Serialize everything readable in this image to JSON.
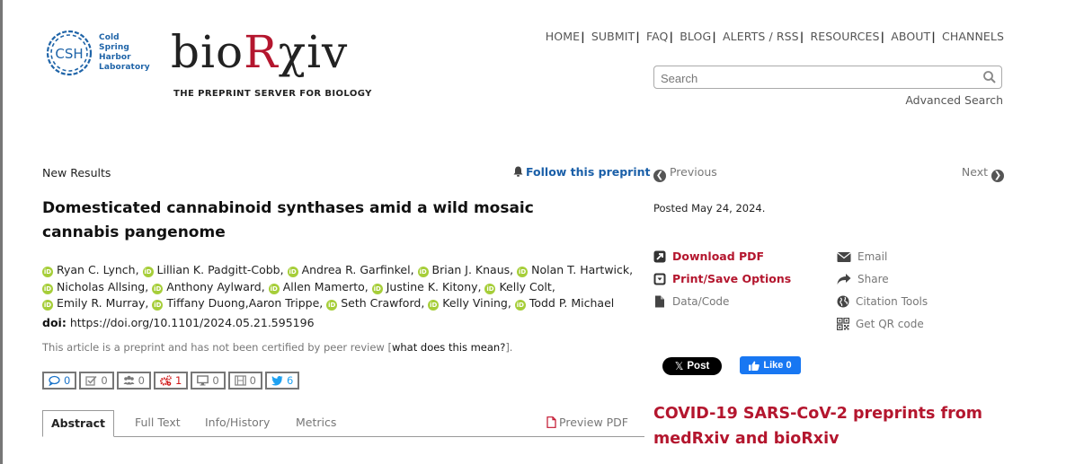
{
  "header": {
    "csh_logo_lines": [
      "Cold",
      "Spring",
      "Harbor",
      "Laboratory"
    ],
    "csh_monogram": "CSH",
    "logo": {
      "part1": "bio",
      "part2": "R",
      "part3": "χiv"
    },
    "tagline": "THE PREPRINT SERVER FOR BIOLOGY",
    "nav": [
      "HOME",
      "SUBMIT",
      "FAQ",
      "BLOG",
      "ALERTS / RSS",
      "RESOURCES",
      "ABOUT",
      "CHANNELS"
    ],
    "search": {
      "placeholder": "Search",
      "value": ""
    },
    "advanced_search": "Advanced Search"
  },
  "article": {
    "section": "New Results",
    "follow": "Follow this preprint",
    "title": "Domesticated cannabinoid synthases amid a wild mosaic cannabis pangenome",
    "authors": [
      {
        "name": "Ryan C. Lynch",
        "orcid": true
      },
      {
        "name": "Lillian K. Padgitt-Cobb",
        "orcid": true
      },
      {
        "name": "Andrea R. Garfinkel",
        "orcid": true
      },
      {
        "name": "Brian J. Knaus",
        "orcid": true
      },
      {
        "name": "Nolan T. Hartwick",
        "orcid": true
      },
      {
        "name": "Nicholas Allsing",
        "orcid": true
      },
      {
        "name": "Anthony Aylward",
        "orcid": true
      },
      {
        "name": "Allen Mamerto",
        "orcid": true
      },
      {
        "name": "Justine K. Kitony",
        "orcid": true
      },
      {
        "name": "Kelly Colt",
        "orcid": true
      },
      {
        "name": "Emily R. Murray",
        "orcid": true
      },
      {
        "name": "Tiffany Duong",
        "orcid": true
      },
      {
        "name": "Aaron Trippe",
        "orcid": false
      },
      {
        "name": "Seth Crawford",
        "orcid": true
      },
      {
        "name": "Kelly Vining",
        "orcid": true
      },
      {
        "name": "Todd P. Michael",
        "orcid": true
      }
    ],
    "doi_label": "doi:",
    "doi": "https://doi.org/10.1101/2024.05.21.595196",
    "disclaimer": "This article is a preprint and has not been certified by peer review [",
    "disclaimer_link": "what does this mean?",
    "disclaimer_end": "].",
    "metrics": [
      {
        "icon": "comment-icon",
        "value": "0",
        "color": "#1a73c9"
      },
      {
        "icon": "checkbox-icon",
        "value": "0",
        "color": "#777777"
      },
      {
        "icon": "users-icon",
        "value": "0",
        "color": "#777777"
      },
      {
        "icon": "gears-icon",
        "value": "1",
        "color": "#d01818"
      },
      {
        "icon": "monitor-icon",
        "value": "0",
        "color": "#777777"
      },
      {
        "icon": "film-icon",
        "value": "0",
        "color": "#777777"
      },
      {
        "icon": "twitter-icon",
        "value": "6",
        "color": "#1da1f2"
      }
    ],
    "tabs": [
      {
        "label": "Abstract",
        "active": true
      },
      {
        "label": "Full Text",
        "active": false
      },
      {
        "label": "Info/History",
        "active": false
      },
      {
        "label": "Metrics",
        "active": false
      }
    ],
    "preview_pdf": "Preview PDF"
  },
  "sidebar": {
    "previous": "Previous",
    "next": "Next",
    "posted": "Posted May 24, 2024.",
    "actions_left": [
      {
        "label": "Download PDF",
        "icon": "external-link-icon",
        "style": "red"
      },
      {
        "label": "Print/Save Options",
        "icon": "dropdown-box-icon",
        "style": "red"
      },
      {
        "label": "Data/Code",
        "icon": "file-icon",
        "style": "gray"
      }
    ],
    "actions_right": [
      {
        "label": "Email",
        "icon": "envelope-icon"
      },
      {
        "label": "Share",
        "icon": "share-icon"
      },
      {
        "label": "Citation Tools",
        "icon": "globe-icon"
      },
      {
        "label": "Get QR code",
        "icon": "qr-code-icon"
      }
    ],
    "x_post": "Post",
    "fb_like": "Like 0",
    "covid_heading": "COVID-19 SARS-CoV-2 preprints from medRxiv and bioRxiv"
  },
  "colors": {
    "brand_red": "#b4162e",
    "link_blue": "#1a5fa8",
    "orcid_green": "#a6ce39",
    "csh_blue": "#1f64a8"
  }
}
